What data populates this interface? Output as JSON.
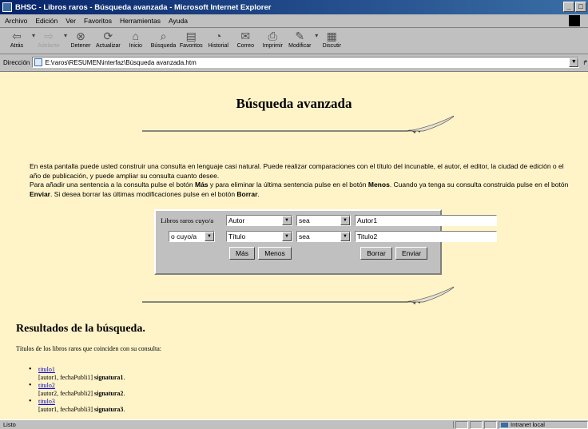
{
  "window": {
    "title": "BHSC - Libros raros - Búsqueda avanzada - Microsoft Internet Explorer"
  },
  "menu": [
    "Archivo",
    "Edición",
    "Ver",
    "Favoritos",
    "Herramientas",
    "Ayuda"
  ],
  "toolbar": {
    "back": "Atrás",
    "forward": "Adelante",
    "stop": "Detener",
    "refresh": "Actualizar",
    "home": "Inicio",
    "search": "Búsqueda",
    "favorites": "Favoritos",
    "history": "Historial",
    "mail": "Correo",
    "print": "Imprimir",
    "edit": "Modificar",
    "discuss": "Discutir"
  },
  "address": {
    "label": "Dirección",
    "url": "E:\\raros\\RESUMEN\\interfaz\\Búsqueda avanzada.htm"
  },
  "page": {
    "heading": "Búsqueda avanzada",
    "intro1": "En esta pantalla puede usted construir una consulta en lenguaje casi natural. Puede realizar comparaciones con el título del incunable, el autor, el editor, la ciudad de edición o el año de publicación, y puede ampliar su consulta cuanto desee.",
    "intro2a": "Para añadir una sentencia a la consulta pulse el botón ",
    "intro2b": "Más",
    "intro2c": " y para eliminar la última sentencia pulse en el botón ",
    "intro2d": "Menos",
    "intro2e": ". Cuando ya tenga su consulta construida pulse en el botón ",
    "intro2f": "Enviar",
    "intro2g": ". Si desea borrar las últimas modificaciones pulse en el botón ",
    "intro2h": "Borrar",
    "intro2i": "."
  },
  "form": {
    "row1": {
      "label": "Libros raros cuyo/a",
      "field": "Autor",
      "op": "sea",
      "value": "Autor1"
    },
    "row2": {
      "connector": "o cuyo/a",
      "field": "Título",
      "op": "sea",
      "value": "Titulo2"
    },
    "buttons": {
      "more": "Más",
      "less": "Menos",
      "clear": "Borrar",
      "submit": "Enviar"
    }
  },
  "results": {
    "title": "Resultados de la búsqueda.",
    "subtitle": "Títulos de los libros raros que coinciden con su consulta:",
    "items": [
      {
        "link": "titulo1",
        "meta": "[autor1, fechaPubli1] ",
        "sig": "signatura1",
        "end": "."
      },
      {
        "link": "titulo2",
        "meta": "[autor2, fechaPubli2] ",
        "sig": "signatura2",
        "end": "."
      },
      {
        "link": "titulo3",
        "meta": "[autor1, fechaPubli3] ",
        "sig": "signatura3",
        "end": "."
      }
    ]
  },
  "status": {
    "left": "Listo",
    "zone": "Intranet local"
  }
}
